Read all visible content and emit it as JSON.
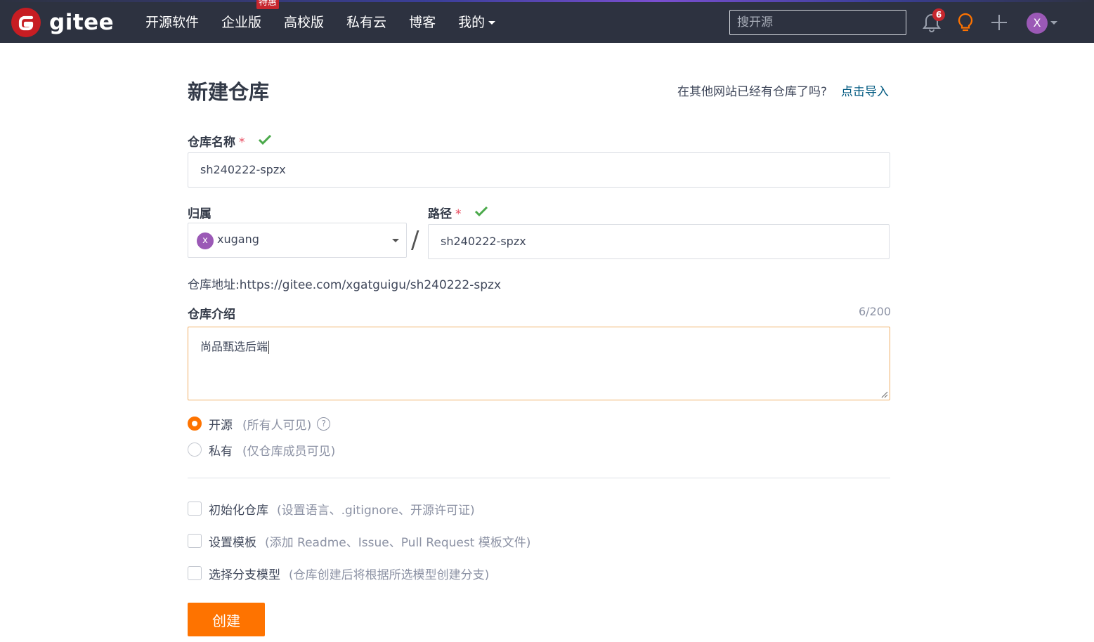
{
  "header": {
    "logo_text": "gitee",
    "nav": [
      {
        "label": "开源软件"
      },
      {
        "label": "企业版",
        "badge": "特惠"
      },
      {
        "label": "高校版"
      },
      {
        "label": "私有云"
      },
      {
        "label": "博客"
      },
      {
        "label": "我的"
      }
    ],
    "search_placeholder": "搜开源",
    "notification_count": "6",
    "avatar_letter": "X"
  },
  "page": {
    "title": "新建仓库",
    "import_question": "在其他网站已经有仓库了吗?",
    "import_link": "点击导入"
  },
  "form": {
    "repo_name_label": "仓库名称",
    "required_mark": "*",
    "repo_name_value": "sh240222-spzx",
    "owner_label": "归属",
    "owner_avatar_letter": "x",
    "owner_value": "xugang",
    "path_separator": "/",
    "path_label": "路径",
    "path_value": "sh240222-spzx",
    "repo_address": "仓库地址:https://gitee.com/xgatguigu/sh240222-spzx",
    "intro_label": "仓库介绍",
    "intro_counter": "6/200",
    "intro_value": "尚品甄选后端",
    "visibility": [
      {
        "label": "开源",
        "note": "(所有人可见)",
        "selected": true,
        "help": "?"
      },
      {
        "label": "私有",
        "note": "(仅仓库成员可见)",
        "selected": false
      }
    ],
    "options": [
      {
        "label": "初始化仓库",
        "note": "(设置语言、.gitignore、开源许可证)",
        "checked": false
      },
      {
        "label": "设置模板",
        "note": "(添加 Readme、Issue、Pull Request 模板文件)",
        "checked": false
      },
      {
        "label": "选择分支模型",
        "note": "(仓库创建后将根据所选模型创建分支)",
        "checked": false
      }
    ],
    "submit_label": "创建"
  },
  "colors": {
    "nav_bg": "#2d3240",
    "accent": "#fe7300",
    "link": "#005980",
    "valid": "#4aa94a",
    "required": "#e84a5f",
    "badge": "#c7272e",
    "avatar": "#9b59b6"
  }
}
